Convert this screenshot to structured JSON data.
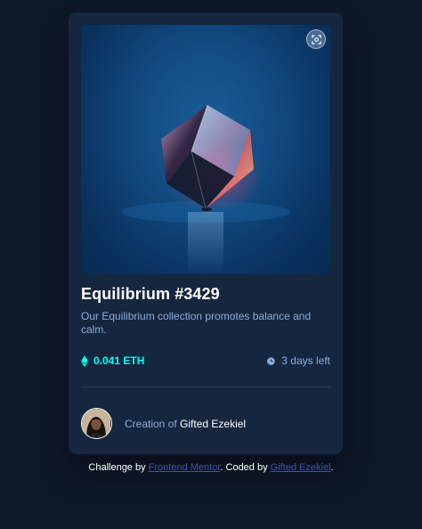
{
  "card": {
    "title": "Equilibrium #3429",
    "description": "Our Equilibrium collection promotes balance and calm.",
    "price": "0.041 ETH",
    "time_left": "3 days left",
    "creator_prefix": "Creation of ",
    "creator_name": "Gifted Ezekiel",
    "icons": {
      "view": "view-icon",
      "ethereum": "ethereum-icon",
      "clock": "clock-icon"
    }
  },
  "attribution": {
    "prefix": "Challenge by ",
    "challenge_link": "Frontend Mentor",
    "middle": ". Coded by ",
    "coder_link": "Gifted Ezekiel",
    "suffix": "."
  },
  "colors": {
    "page_bg": "#0d1829",
    "card_bg": "#15263f",
    "accent_cyan": "#00fff8",
    "soft_blue": "#8bacd9",
    "link_blue": "#3e52a3",
    "white": "#ffffff"
  }
}
